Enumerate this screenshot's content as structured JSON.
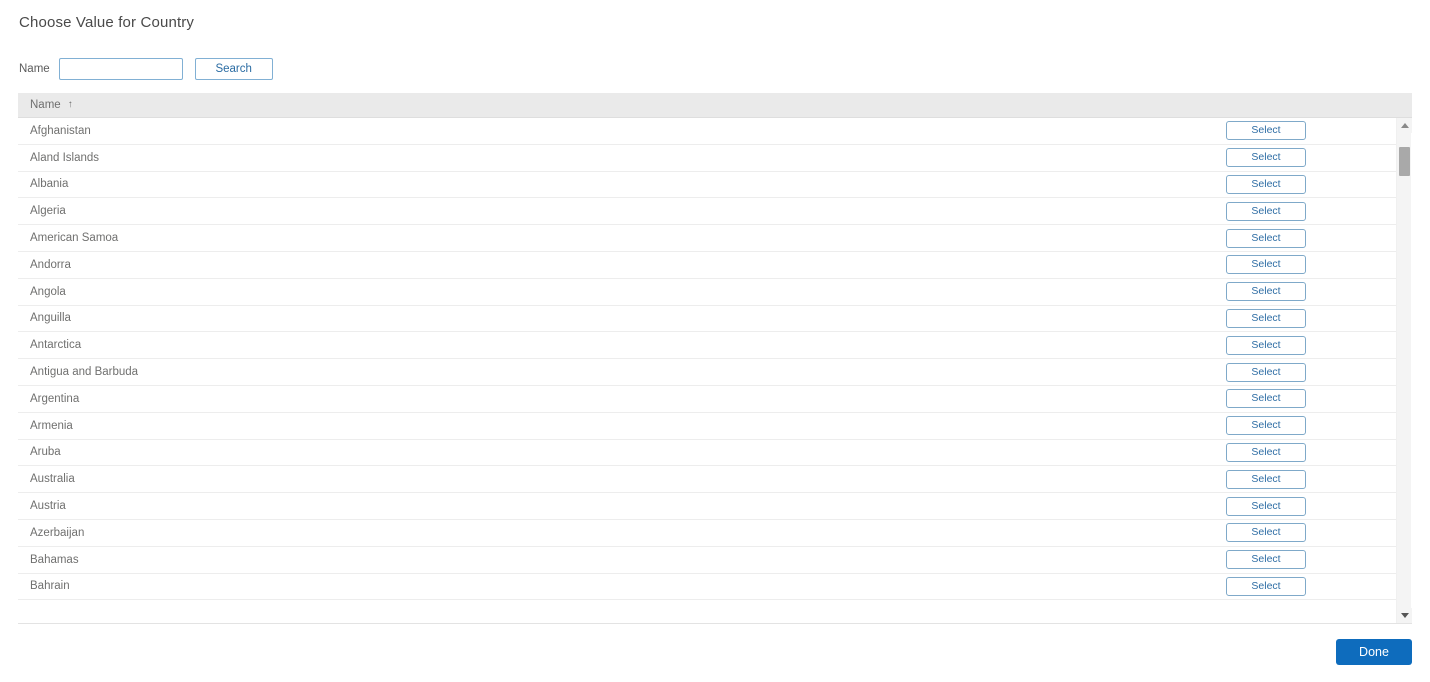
{
  "dialog": {
    "title": "Choose Value for Country"
  },
  "search": {
    "label": "Name",
    "value": "",
    "placeholder": "",
    "button_label": "Search"
  },
  "table": {
    "columns": [
      "Name"
    ],
    "sort_column": "Name",
    "sort_direction": "asc",
    "sort_icon": "arrow-up-icon",
    "sort_glyph": "↑",
    "row_action_label": "Select",
    "rows": [
      {
        "name": "Afghanistan"
      },
      {
        "name": "Aland Islands"
      },
      {
        "name": "Albania"
      },
      {
        "name": "Algeria"
      },
      {
        "name": "American Samoa"
      },
      {
        "name": "Andorra"
      },
      {
        "name": "Angola"
      },
      {
        "name": "Anguilla"
      },
      {
        "name": "Antarctica"
      },
      {
        "name": "Antigua and Barbuda"
      },
      {
        "name": "Argentina"
      },
      {
        "name": "Armenia"
      },
      {
        "name": "Aruba"
      },
      {
        "name": "Australia"
      },
      {
        "name": "Austria"
      },
      {
        "name": "Azerbaijan"
      },
      {
        "name": "Bahamas"
      },
      {
        "name": "Bahrain"
      }
    ]
  },
  "scrollbar": {
    "up_icon": "triangle-up-icon",
    "down_icon": "triangle-down-icon",
    "thumb_top_pct": 3,
    "thumb_height_pct": 6
  },
  "footer": {
    "done_label": "Done"
  },
  "colors": {
    "primary": "#0e6cbd",
    "link": "#2e6da4",
    "border_blue": "#81b0d4",
    "header_bg": "#eaeaea",
    "text": "#70706f",
    "title": "#4a4a4a"
  }
}
